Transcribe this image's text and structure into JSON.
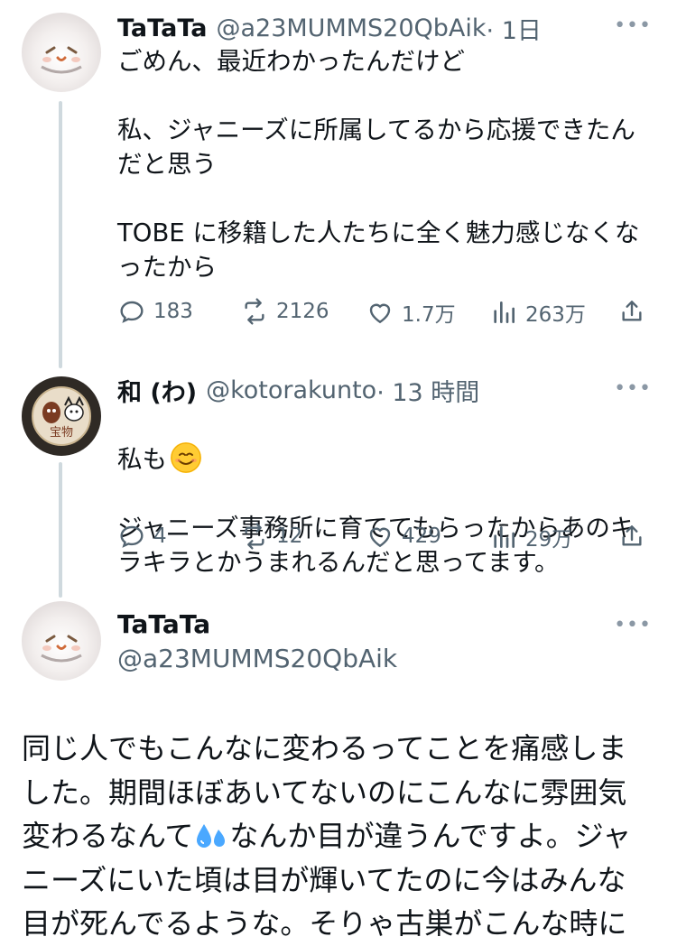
{
  "thread": [
    {
      "name": "TaTaTa",
      "handle": "@a23MUMMS20QbAik",
      "time": "· 1日",
      "text": "ごめん、最近わかったんだけど\n\n私、ジャニーズに所属してるから応援できたんだと思う\n\nTOBE に移籍した人たちに全く魅力感じなくなったから",
      "replies": "183",
      "retweets": "2126",
      "likes": "1.7万",
      "views": "263万"
    },
    {
      "name": "和 (わ)",
      "handle": "@kotorakunto",
      "time": "· 13 時間",
      "text_line1": "私も",
      "text_rest": "ジャニーズ事務所に育ててもらったからあのキラキラとかうまれるんだと思ってます。",
      "replies": "4",
      "retweets": "12",
      "likes": "429",
      "views": "29万",
      "avatar_text": "宝物"
    }
  ],
  "main": {
    "name": "TaTaTa",
    "handle": "@a23MUMMS20QbAik",
    "text_part1": "同じ人でもこんなに変わるってことを痛感しました。期間ほぼあいてないのにこんなに雰囲気変わるなんて",
    "text_part2": "なんか目が違うんですよ。ジャニーズにいた頃は目が輝いてたのに今はみんな目が死んでるような。そりゃ古巣がこんな時に"
  },
  "more_label": "•••",
  "colors": {
    "text": "#0f1419",
    "secondary": "#536471",
    "line": "#cfd9de"
  },
  "icons": [
    "reply-icon",
    "retweet-icon",
    "like-icon",
    "views-icon",
    "share-icon",
    "more-icon"
  ]
}
